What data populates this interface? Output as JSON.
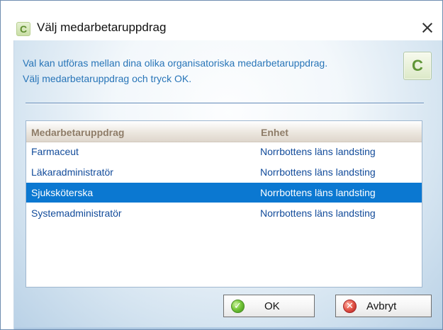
{
  "window": {
    "title": "Välj medarbetaruppdrag",
    "app_icon_letter": "C",
    "close_symbol": "×"
  },
  "intro": {
    "line1": "Val kan utföras mellan dina olika organisatoriska medarbetaruppdrag.",
    "line2": "Välj medarbetaruppdrag och tryck OK."
  },
  "corner_logo": {
    "letter": "C"
  },
  "table": {
    "columns": [
      {
        "label": "Medarbetaruppdrag"
      },
      {
        "label": "Enhet"
      }
    ],
    "rows": [
      {
        "role": "Farmaceut",
        "unit": "Norrbottens läns landsting",
        "selected": false
      },
      {
        "role": "Läkaradministratör",
        "unit": "Norrbottens läns landsting",
        "selected": false
      },
      {
        "role": "Sjuksköterska",
        "unit": "Norrbottens läns landsting",
        "selected": true
      },
      {
        "role": "Systemadministratör",
        "unit": "Norrbottens läns landsting",
        "selected": false
      }
    ]
  },
  "buttons": {
    "ok": {
      "label": "OK",
      "icon": "check-circle-icon"
    },
    "cancel": {
      "label": "Avbryt",
      "icon": "cancel-circle-icon"
    }
  },
  "colors": {
    "selection": "#0b78d1",
    "link_text": "#124b9a",
    "info_text": "#2875b8",
    "header_text": "#8f7d69"
  }
}
